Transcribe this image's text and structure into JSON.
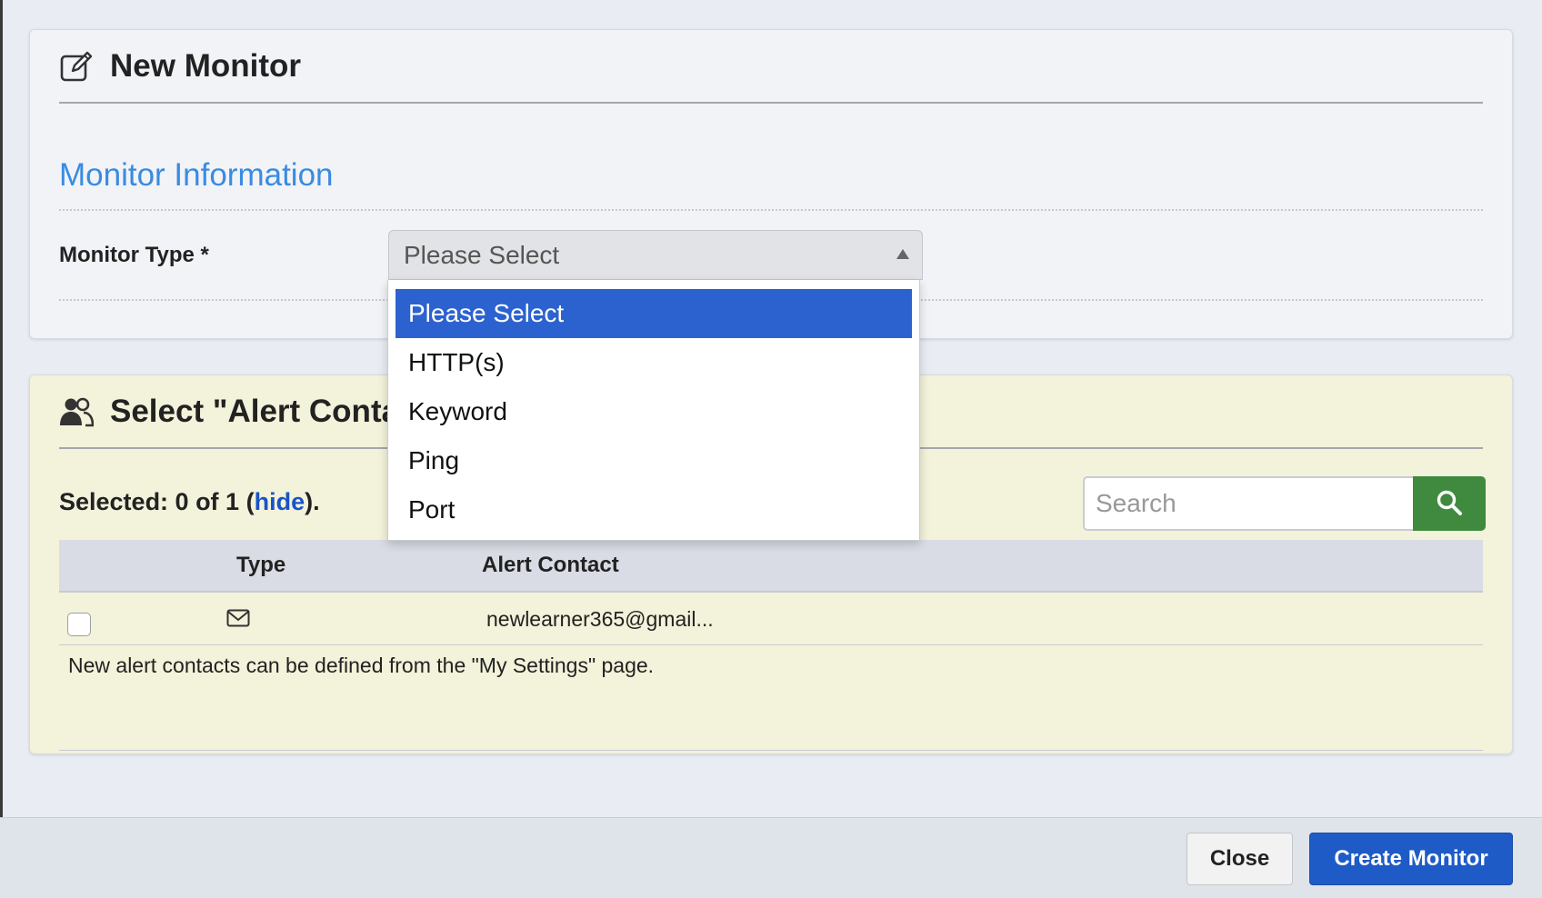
{
  "info_panel": {
    "title": "New Monitor",
    "title_icon": "edit-icon",
    "section_title": "Monitor Information",
    "monitor_type_label": "Monitor Type *",
    "select_value": "Please Select",
    "dropdown_options": [
      "Please Select",
      "HTTP(s)",
      "Keyword",
      "Ping",
      "Port"
    ],
    "dropdown_selected_index": 0
  },
  "alert_panel": {
    "title": "Select \"Alert Contacts To Notify\"",
    "title_icon": "users-icon",
    "selected_prefix": "Selected: 0 of 1 (",
    "hide_link": "hide",
    "selected_suffix": ").",
    "search_placeholder": "Search",
    "search_icon": "search-icon",
    "columns": [
      "Type",
      "Alert Contact"
    ],
    "rows": [
      {
        "type_icon": "envelope-icon",
        "contact": "newlearner365@gmail...",
        "checked": false
      }
    ],
    "note": "New alert contacts can be defined from the \"My Settings\" page."
  },
  "footer": {
    "close_label": "Close",
    "create_label": "Create Monitor"
  },
  "colors": {
    "accent_blue": "#3a8be0",
    "selected_option": "#2c62cf",
    "search_button": "#3f8a3e",
    "primary_button": "#1f5bc6",
    "alert_panel_bg": "#f3f2da"
  }
}
